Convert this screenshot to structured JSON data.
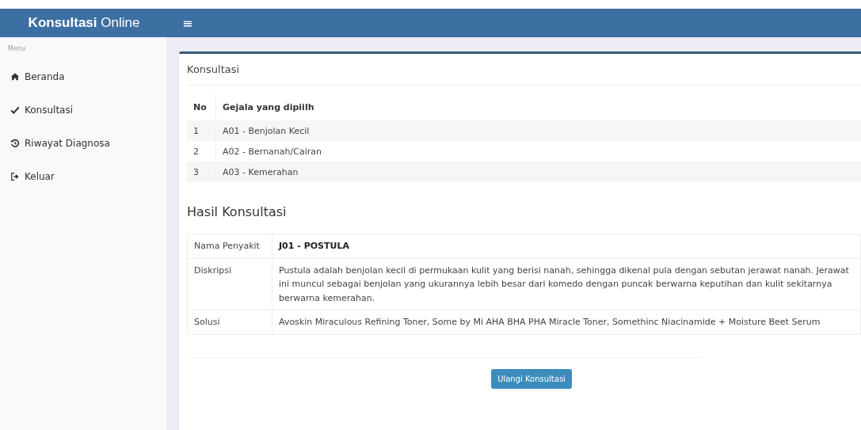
{
  "header": {
    "brand_bold": "Konsultasi",
    "brand_light": "Online",
    "menu_toggle": "≡"
  },
  "sidebar": {
    "heading": "Menu",
    "items": [
      {
        "label": "Beranda",
        "kind": "home"
      },
      {
        "label": "Konsultasi",
        "kind": "check"
      },
      {
        "label": "Riwayat Diagnosa",
        "kind": "history"
      },
      {
        "label": "Keluar",
        "kind": "logout"
      }
    ]
  },
  "card": {
    "title": "Konsultasi",
    "symptoms_table": {
      "columns": [
        "No",
        "Gejala yang dipiilh"
      ],
      "rows": [
        [
          "1",
          "A01 - Benjolan Kecil"
        ],
        [
          "2",
          "A02 - Bernanah/Cairan"
        ],
        [
          "3",
          "A03 - Kemerahan"
        ]
      ]
    },
    "result_title": "Hasil Konsultasi",
    "result_table": [
      {
        "label": "Nama Penyakit",
        "value": "J01 - POSTULA",
        "kind": "bold"
      },
      {
        "label": "Diskripsi",
        "value": "Pustula adalah benjolan kecil di permukaan kulit yang berisi nanah, sehingga dikenal pula dengan sebutan jerawat nanah. Jerawat ini muncul sebagai benjolan yang ukurannya lebih besar dari komedo dengan puncak berwarna keputihan dan kulit sekitarnya berwarna kemerahan.",
        "kind": "plain"
      },
      {
        "label": "Solusi",
        "value": "Avoskin Miraculous Refining Toner, Some by Mi AHA BHA PHA Miracle Toner, Somethinc Niacinamide  + Moisture Beet Serum",
        "kind": "plain"
      }
    ],
    "button": "Ulangi Konsultasi"
  }
}
